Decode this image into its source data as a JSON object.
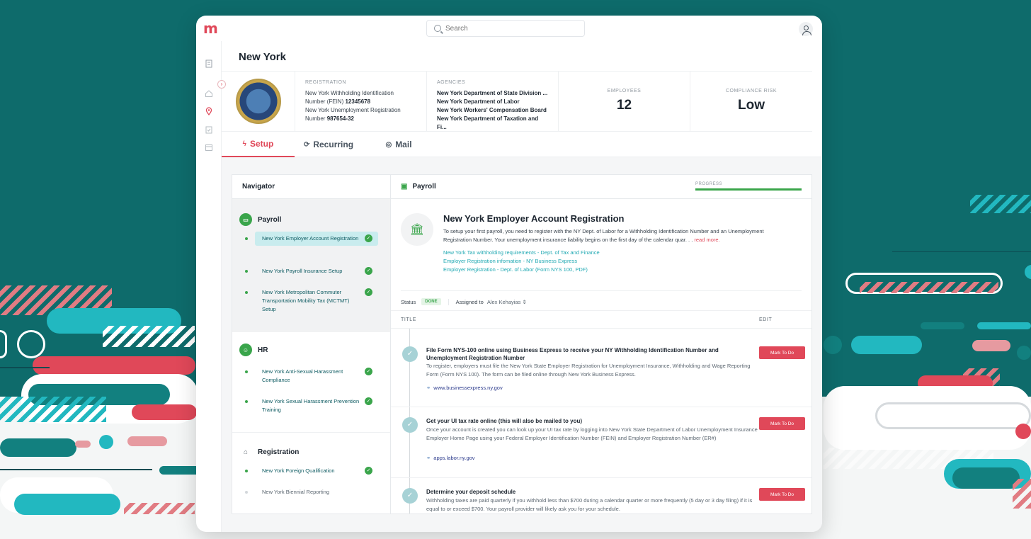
{
  "app": {
    "logo": "m"
  },
  "search": {
    "placeholder": "Search"
  },
  "page": {
    "title": "New York"
  },
  "info": {
    "registration_label": "REGISTRATION",
    "registration_lines": [
      "New York Withholding Identification",
      "Number (FEIN)",
      "12345678",
      "New York Unemployment Registration",
      "Number",
      "987654-32"
    ],
    "agencies_label": "AGENCIES",
    "agencies": [
      "New York Department of State Division ...",
      "New York Department of Labor",
      "New York Workers' Compensation Board",
      "New York Department of Taxation and Fi..."
    ],
    "employees_label": "EMPLOYEES",
    "employees_value": "12",
    "risk_label": "COMPLIANCE RISK",
    "risk_value": "Low"
  },
  "tabs": [
    {
      "label": "Setup",
      "icon": "bolt-icon"
    },
    {
      "label": "Recurring",
      "icon": "refresh-icon"
    },
    {
      "label": "Mail",
      "icon": "pin-icon"
    }
  ],
  "navigator": {
    "title": "Navigator",
    "groups": [
      {
        "title": "Payroll",
        "items": [
          "New York Employer Account Registration",
          "New York Payroll Insurance Setup",
          "New York Metropolitan Commuter Transportation Mobility Tax (MCTMT) Setup"
        ]
      },
      {
        "title": "HR",
        "items": [
          "New York Anti-Sexual Harassment Compliance",
          "New York Sexual Harassment Prevention Training"
        ]
      },
      {
        "title": "Registration",
        "items": [
          "New York Foreign Qualification",
          "New York Biennial Reporting"
        ]
      }
    ]
  },
  "detail": {
    "section": "Payroll",
    "progress_label": "PROGRESS",
    "progress_value": 1.0,
    "title": "New York Employer Account Registration",
    "description": "To setup your first payroll, you need to register with the NY Dept. of Labor for a Withholding Identification Number and an Unemployment Registration Number. Your unemployment insurance liability begins on the first day of the calendar quar. . .",
    "read_more": "read more.",
    "links": [
      "New York Tax withholding requirements - Dept. of Tax and Finance",
      "Employer Registration infomation - NY Business Express",
      "Employer Registration - Dept. of Labor (Form NYS 100, PDF)"
    ],
    "status_label": "Status",
    "status_value": "DONE",
    "assigned_label": "Assigned to",
    "assigned_value": "Alex Kehayias",
    "col_title": "TITLE",
    "col_edit": "EDIT",
    "todos": [
      {
        "title": "File Form NYS-100 online using Business Express to receive your NY Withholding Identification Number and Unemployment Registration Number",
        "body": "To register, employers must file the New York State Employer Registration for Unemployment Insurance, Withholding and Wage Reporting Form (Form NYS 100). The form can be filed online through New York Business Express.",
        "link": "www.businessexpress.ny.gov",
        "button": "Mark To Do"
      },
      {
        "title": "Get your UI tax rate online (this will also be mailed to you)",
        "body": "Once your account is created you can look up your UI tax rate by logging into New York State Department of Labor Unemployment Insurance Employer Home Page using your Federal Employer Identification Number (FEIN) and Employer Registration Number (ER#)",
        "link": "apps.labor.ny.gov",
        "button": "Mark To Do"
      },
      {
        "title": "Determine your deposit schedule",
        "body": "Withholding taxes are paid quarterly if you withhold less than $700 during a calendar quarter or more frequently (5 day or 3 day filing) if it is equal to or exceed $700. Your payroll provider will likely ask you for your schedule.",
        "link": "",
        "button": "Mark To Do"
      }
    ]
  },
  "colors": {
    "accent": "#e04859",
    "success": "#3aa54b",
    "link": "#21a9b3",
    "background": "#0e6b6b"
  }
}
